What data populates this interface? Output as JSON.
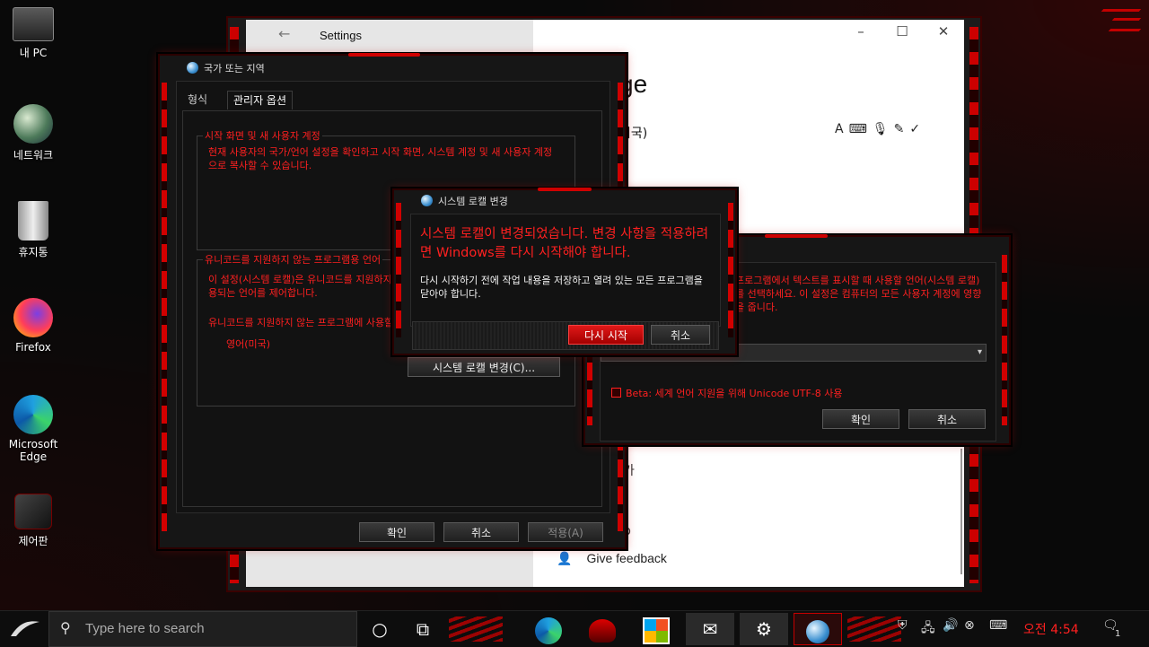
{
  "desktop": {
    "icons": [
      {
        "label": "내 PC"
      },
      {
        "label": "네트워크"
      },
      {
        "label": "휴지통"
      },
      {
        "label": "Firefox"
      },
      {
        "label": "Microsoft Edge"
      },
      {
        "label": "제어판"
      }
    ]
  },
  "settings": {
    "title": "Settings",
    "heading_fragment": "ge",
    "language_line_fragment": "미국)",
    "ga_fragment": "가",
    "p_fragment": "p",
    "feedback": "Give feedback"
  },
  "region_dialog": {
    "title": "국가 또는 지역",
    "tabs": [
      "형식",
      "관리자 옵션"
    ],
    "welcome_group": {
      "legend": "시작 화면 및 새 사용자 계정",
      "text": "현재 사용자의 국가/언어 설정을 확인하고 시작 화면, 시스템 계정 및 새 사용자 계정으로 복사할 수 있습니다."
    },
    "unicode_group": {
      "legend": "유니코드를 지원하지 않는 프로그램용 언어",
      "text": "이 설정(시스템 로캘)은 유니코드를 지원하지 않는 프로그램에서 텍스트를 표시할 때 사용되는 언어를 제어합니다.",
      "current_label": "유니코드를 지원하지 않는 프로그램에 사용할 현재 언어:",
      "current_value": "영어(미국)",
      "change_button": "시스템 로캘 변경(C)..."
    },
    "ok": "확인",
    "cancel": "취소",
    "apply": "적용(A)"
  },
  "locale_settings_dialog": {
    "text": "프로그램에서 텍스트를 표시할 때 사용할 언어(시스템 로캘)를 선택하세요. 이 설정은 컴퓨터의 모든 사용자 계정에 영향을 줍니다.",
    "beta_label": "Beta: 세계 언어 지원을 위해 Unicode UTF-8 사용",
    "ok": "확인",
    "cancel": "취소"
  },
  "restart_dialog": {
    "title": "시스템 로캘 변경",
    "main_message": "시스템 로캘이 변경되었습니다. 변경 사항을 적용하려면 Windows를 다시 시작해야 합니다.",
    "sub_message": "다시 시작하기 전에 작업 내용을 저장하고 열려 있는 모든 프로그램을 닫아야 합니다.",
    "restart_button": "다시 시작",
    "cancel_button": "취소"
  },
  "taskbar": {
    "search_placeholder": "Type here to search",
    "clock": "오전 4:54",
    "notification_count": "1"
  }
}
